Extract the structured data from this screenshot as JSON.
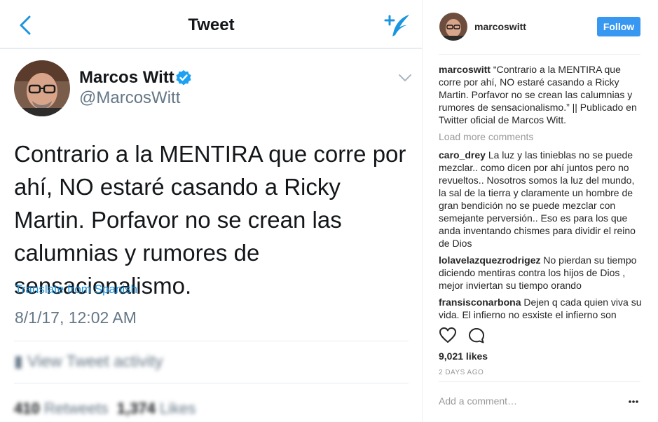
{
  "tweet": {
    "header_title": "Tweet",
    "author_name": "Marcos Witt",
    "author_handle": "@MarcosWitt",
    "text": "Contrario a la MENTIRA que corre por ahí, NO estaré casando a Ricky Martin. Porfavor no se crean las calumnias y rumores de sensacionalismo.",
    "translate_label": "Translate from Spanish",
    "date": "8/1/17, 12:02 AM",
    "activity_label": "View Tweet activity",
    "retweets_count": "410",
    "retweets_label": "Retweets",
    "likes_count": "1,374",
    "likes_label": "Likes",
    "colors": {
      "link": "#1b95e0",
      "muted": "#657786",
      "text": "#14171a"
    },
    "icons": [
      "back-chevron-icon",
      "compose-tweet-icon",
      "verified-badge-icon",
      "caret-down-icon"
    ]
  },
  "instagram": {
    "username": "marcoswitt",
    "follow_label": "Follow",
    "caption_user": "marcoswitt",
    "caption_text": "“Contrario a la MENTIRA que corre por ahí, NO estaré casando a Ricky Martin. Porfavor no se crean las calumnias y rumores de sensacionalismo.” || Publicado en Twitter oficial de Marcos Witt.",
    "load_more_label": "Load more comments",
    "comments": [
      {
        "user": "caro_drey",
        "text": "La luz y las tinieblas no se puede mezclar.. como dicen por ahí juntos pero no revueltos.. Nosotros somos la luz del mundo, la sal de la tierra y claramente un hombre de gran bendición no se puede mezclar con semejante perversión.. Eso es para los que anda inventando chismes para dividir el reino de Dios"
      },
      {
        "user": "lolavelazquezrodrigez",
        "text": "No pierdan su tiempo diciendo mentiras contra los hijos de Dios , mejor inviertan su tiempo orando"
      },
      {
        "user": "fransisconarbona",
        "text": "Dejen q cada quien viva su vida. El infierno no esxiste el infierno son"
      }
    ],
    "likes": "9,021 likes",
    "time_ago": "2 DAYS AGO",
    "comment_placeholder": "Add a comment…",
    "colors": {
      "follow": "#3897f0",
      "muted": "#999999"
    },
    "icons": [
      "heart-icon",
      "comment-bubble-icon",
      "more-options-icon"
    ]
  }
}
